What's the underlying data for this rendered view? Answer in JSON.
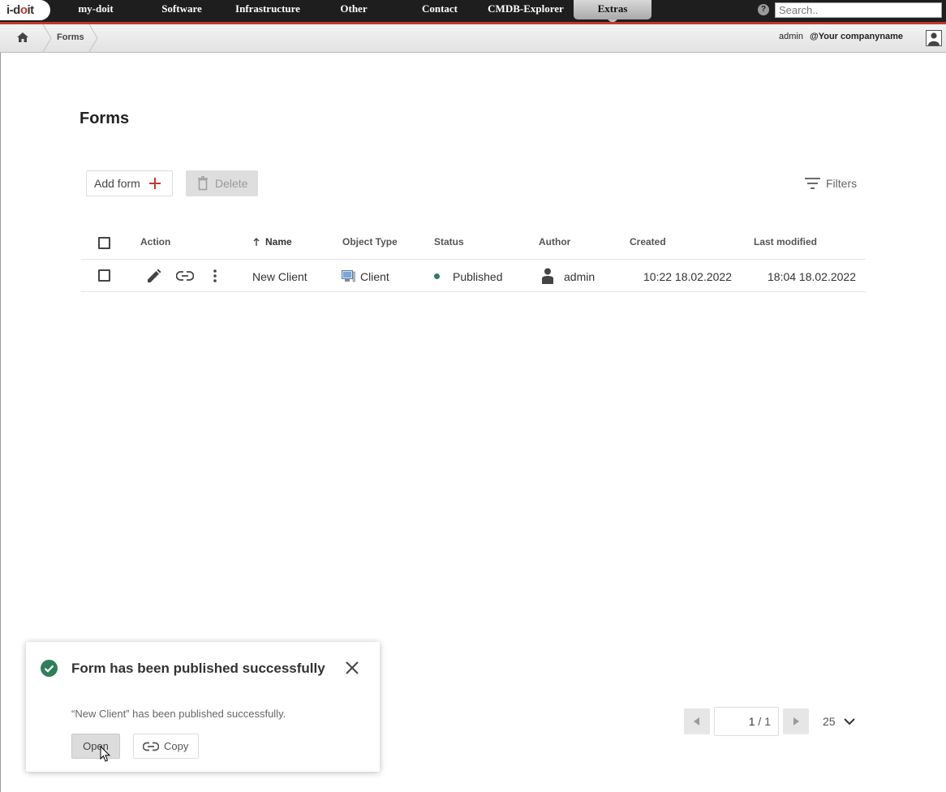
{
  "app": {
    "logo": {
      "part1": "i-d",
      "part2": "o",
      "part3": "it"
    }
  },
  "nav": {
    "items": [
      {
        "label": "my-doit"
      },
      {
        "label": "Software"
      },
      {
        "label": "Infrastructure"
      },
      {
        "label": "Other"
      },
      {
        "label": "Contact"
      },
      {
        "label": "CMDB-Explorer"
      },
      {
        "label": "Extras",
        "active": true
      }
    ],
    "search_placeholder": "Search.."
  },
  "breadcrumb": {
    "home_icon": "home-icon",
    "items": [
      {
        "label": "Forms"
      }
    ]
  },
  "user": {
    "name": "admin",
    "company": "@Your companyname"
  },
  "page": {
    "title": "Forms",
    "add_label": "Add form",
    "delete_label": "Delete",
    "filters_label": "Filters"
  },
  "table": {
    "columns": {
      "action": "Action",
      "name": "Name",
      "object_type": "Object Type",
      "status": "Status",
      "author": "Author",
      "created": "Created",
      "last_modified": "Last modified"
    },
    "sort": {
      "column": "name",
      "direction": "ascending"
    },
    "rows": [
      {
        "name": "New Client",
        "object_type": "Client",
        "status": "Published",
        "author": "admin",
        "created": "10:22 18.02.2022",
        "last_modified": "18:04 18.02.2022"
      }
    ]
  },
  "pagination": {
    "current": "1",
    "total_label": "/ 1",
    "per_page": "25"
  },
  "toast": {
    "title": "Form has been published successfully",
    "message": "“New Client” has been published successfully.",
    "open_label": "Open",
    "copy_label": "Copy"
  },
  "colors": {
    "nav_bg": "#1e1e1e",
    "accent": "#c0392b",
    "status_published": "#2e7d5b",
    "success": "#2e7d5b"
  }
}
